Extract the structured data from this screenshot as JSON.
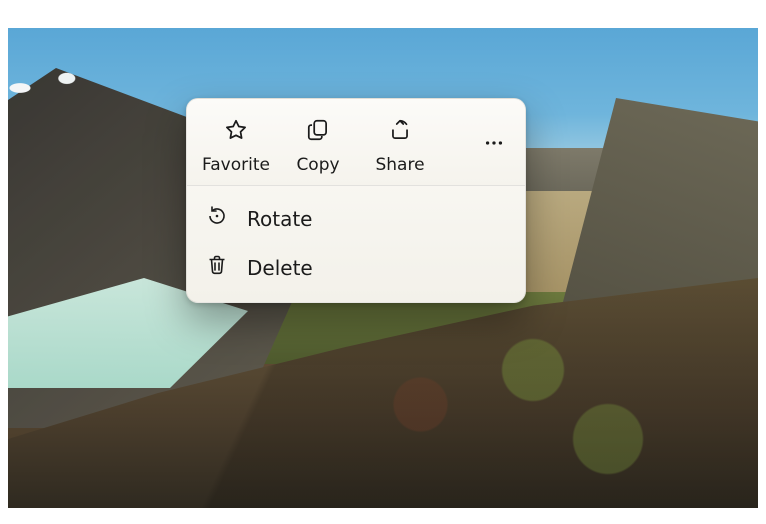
{
  "toolbar": {
    "favorite_label": "Favorite",
    "copy_label": "Copy",
    "share_label": "Share"
  },
  "menu": {
    "rotate_label": "Rotate",
    "delete_label": "Delete"
  }
}
